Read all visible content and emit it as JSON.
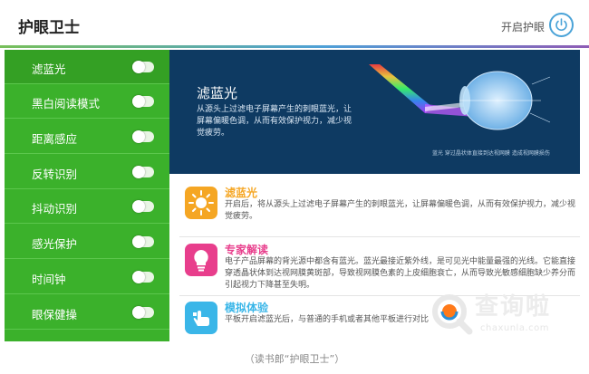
{
  "header": {
    "title": "护眼卫士",
    "eye_toggle_label": "开启护眼"
  },
  "sidebar": {
    "items": [
      {
        "label": "滤蓝光"
      },
      {
        "label": "黑白阅读模式"
      },
      {
        "label": "距离感应"
      },
      {
        "label": "反转识别"
      },
      {
        "label": "抖动识别"
      },
      {
        "label": "感光保护"
      },
      {
        "label": "时间钟"
      },
      {
        "label": "眼保健操"
      }
    ]
  },
  "banner": {
    "title": "滤蓝光",
    "desc": "从源头上过滤电子屏幕产生的刺眼蓝光，让屏幕偏暖色调，从而有效保护视力，减少视觉疲劳。",
    "caption": "蓝光 穿过晶状体直接到达视网膜 造成视网膜损伤"
  },
  "cards": [
    {
      "title": "滤蓝光",
      "desc": "开启后，将从源头上过滤电子屏幕产生的刺眼蓝光，让屏幕偏暖色调，从而有效保护视力，减少视觉疲劳。",
      "accent": "#f5a623",
      "icon": "sun-icon"
    },
    {
      "title": "专家解读",
      "desc": "电子产品屏幕的背光源中都含有蓝光。蓝光最接近紫外线，是可见光中能量最强的光线。它能直接穿透晶状体到达视网膜黄斑部，导致视网膜色素的上皮细胞衰亡，从而导致光敏感细胞缺少养分而引起视力下降甚至失明。",
      "accent": "#e83e8c",
      "icon": "lightbulb-icon"
    },
    {
      "title": "模拟体验",
      "desc": "平板开启滤蓝光后，与普通的手机或者其他平板进行对比",
      "accent": "#3ab6e8",
      "icon": "hand-icon"
    }
  ],
  "caption": "（读书郎“护眼卫士”）",
  "watermark": {
    "text": "查询啦",
    "url": "chaxunla.com"
  }
}
